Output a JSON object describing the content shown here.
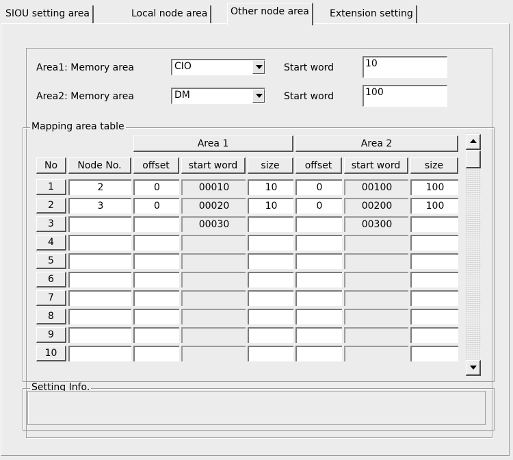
{
  "tabs": [
    {
      "label": "SIOU setting area",
      "active": false
    },
    {
      "label": "Local node area",
      "active": false
    },
    {
      "label": "Other node area",
      "active": true
    },
    {
      "label": "Extension setting",
      "active": false
    }
  ],
  "area1": {
    "label": "Area1: Memory area",
    "memory_value": "CIO",
    "start_label": "Start word",
    "start_value": "10"
  },
  "area2": {
    "label": "Area2: Memory area",
    "memory_value": "DM",
    "start_label": "Start word",
    "start_value": "100"
  },
  "mapping": {
    "title": "Mapping area table",
    "group1": "Area 1",
    "group2": "Area 2",
    "columns": [
      "No",
      "Node No.",
      "offset",
      "start word",
      "size",
      "offset",
      "start word",
      "size"
    ],
    "rows": [
      [
        "1",
        "2",
        "0",
        "00010",
        "10",
        "0",
        "00100",
        "100"
      ],
      [
        "2",
        "3",
        "0",
        "00020",
        "10",
        "0",
        "00200",
        "100"
      ],
      [
        "3",
        "",
        "",
        "00030",
        "",
        "",
        "00300",
        ""
      ],
      [
        "4",
        "",
        "",
        "",
        "",
        "",
        "",
        ""
      ],
      [
        "5",
        "",
        "",
        "",
        "",
        "",
        "",
        ""
      ],
      [
        "6",
        "",
        "",
        "",
        "",
        "",
        "",
        ""
      ],
      [
        "7",
        "",
        "",
        "",
        "",
        "",
        "",
        ""
      ],
      [
        "8",
        "",
        "",
        "",
        "",
        "",
        "",
        ""
      ],
      [
        "9",
        "",
        "",
        "",
        "",
        "",
        "",
        ""
      ],
      [
        "10",
        "",
        "",
        "",
        "",
        "",
        "",
        ""
      ]
    ]
  },
  "setting_info": {
    "title": "Setting Info.",
    "text": ""
  }
}
